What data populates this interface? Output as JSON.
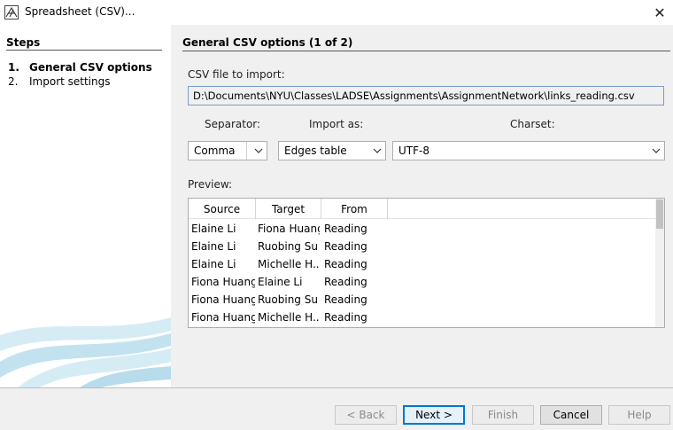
{
  "window": {
    "title": "Spreadsheet (CSV)...",
    "close_glyph": "✕"
  },
  "steps": {
    "title": "Steps",
    "items": [
      {
        "num": "1.",
        "label": "General CSV options",
        "active": true
      },
      {
        "num": "2.",
        "label": "Import settings",
        "active": false
      }
    ]
  },
  "main": {
    "title": "General CSV options (1 of 2)",
    "file_label": "CSV file to import:",
    "file_path": "D:\\Documents\\NYU\\Classes\\LADSE\\Assignments\\AssignmentNetwork\\links_reading.csv",
    "separator_label": "Separator:",
    "separator_value": "Comma",
    "import_as_label": "Import as:",
    "import_as_value": "Edges table",
    "charset_label": "Charset:",
    "charset_value": "UTF-8",
    "preview_label": "Preview:"
  },
  "preview": {
    "columns": [
      "Source",
      "Target",
      "From"
    ],
    "rows": [
      [
        "Elaine Li",
        "Fiona Huang",
        "Reading"
      ],
      [
        "Elaine Li",
        "Ruobing Su",
        "Reading"
      ],
      [
        "Elaine Li",
        "Michelle H...",
        "Reading"
      ],
      [
        "Fiona Huang",
        "Elaine Li",
        "Reading"
      ],
      [
        "Fiona Huang",
        "Ruobing Su",
        "Reading"
      ],
      [
        "Fiona Huang",
        "Michelle H...",
        "Reading"
      ]
    ]
  },
  "buttons": {
    "back": "< Back",
    "next": "Next >",
    "finish": "Finish",
    "cancel": "Cancel",
    "help": "Help"
  },
  "icons": {
    "app": "gephi-app-icon",
    "close": "close-icon",
    "dropdown": "chevron-down-icon"
  }
}
